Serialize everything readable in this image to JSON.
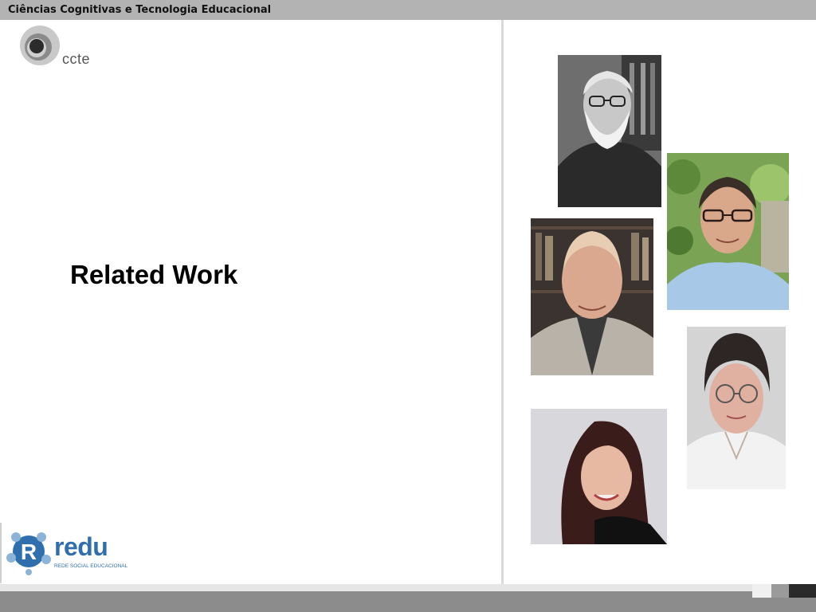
{
  "header": {
    "title": "Ciências Cogni­tivas e Tecnologia Educacional"
  },
  "logos": {
    "ccte": {
      "text": "ccte",
      "icon": "ccte-logo-icon"
    },
    "redu": {
      "word": "redu",
      "tagline": "REDE SOCIAL EDUCACIONAL",
      "icon": "redu-logo-icon"
    }
  },
  "slide": {
    "title": "Related Work"
  },
  "colors": {
    "top_bar": "#b3b3b3",
    "bottom_bar": "#8c8c8c",
    "redu_blue": "#2f6fad"
  },
  "photos": [
    {
      "name": "bearded-man-photo",
      "tone": "grayscale"
    },
    {
      "name": "man-with-glasses-photo",
      "tone": "color"
    },
    {
      "name": "balding-man-photo",
      "tone": "color"
    },
    {
      "name": "woman-with-glasses-photo",
      "tone": "color"
    },
    {
      "name": "young-woman-photo",
      "tone": "color"
    }
  ]
}
